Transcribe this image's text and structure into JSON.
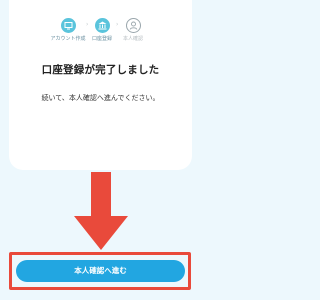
{
  "stepper": {
    "steps": [
      {
        "label": "アカウント作成",
        "state": "done",
        "icon": "monitor-icon"
      },
      {
        "label": "口座登録",
        "state": "done",
        "icon": "bank-icon"
      },
      {
        "label": "本人確認",
        "state": "pending",
        "icon": "person-icon"
      }
    ],
    "arrow_glyph": "›"
  },
  "main": {
    "title": "口座登録が完了しました",
    "subtitle": "続いて、本人確認へ進んでください。"
  },
  "cta": {
    "label": "本人確認へ進む"
  },
  "colors": {
    "background": "#edf8fd",
    "step_done": "#5ac4dc",
    "cta": "#22a6e1",
    "annotation_red": "#e94a3b"
  }
}
